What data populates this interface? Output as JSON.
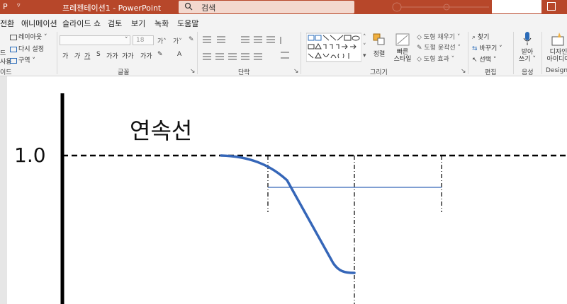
{
  "titlebar": {
    "app_icon": "P",
    "dropdown": "▿",
    "title": "프레젠테이션1  -  PowerPoint",
    "search_placeholder": "검색"
  },
  "tabs": [
    "전환",
    "애니메이션",
    "슬라이드 쇼",
    "검토",
    "보기",
    "녹화",
    "도움말"
  ],
  "ribbon": {
    "slides": {
      "items": [
        "레이아웃 ˅",
        "다시 설정",
        "구역 ˅"
      ],
      "left_labels": [
        "드",
        "사용"
      ],
      "group": "이드"
    },
    "font": {
      "font_size": "18",
      "group": "글꼴",
      "buttons": [
        "가",
        "가",
        "가",
        "S",
        "가가",
        "가가",
        "A"
      ]
    },
    "paragraph": {
      "group": "단락"
    },
    "drawing": {
      "group": "그리기",
      "arrange": "정렬",
      "quick_styles": "빠른\n스타일",
      "fill": "도형 채우기 ˅",
      "outline": "도형 윤곽선 ˅",
      "effects": "도형 효과 ˅"
    },
    "editing": {
      "group": "편집",
      "find": "찾기",
      "replace": "바꾸기 ˅",
      "select": "선택 ˅"
    },
    "voice": {
      "group": "음성",
      "dictate": "받아\n쓰기 ˅"
    },
    "designer": {
      "group": "Designer",
      "label": "디자인\n아이디어"
    }
  },
  "slide": {
    "title": "연속선",
    "y_tick": "1.0"
  },
  "colors": {
    "accent": "#b7472a",
    "curve": "#3566b8",
    "ribbon_bg": "#f3f3f3"
  }
}
